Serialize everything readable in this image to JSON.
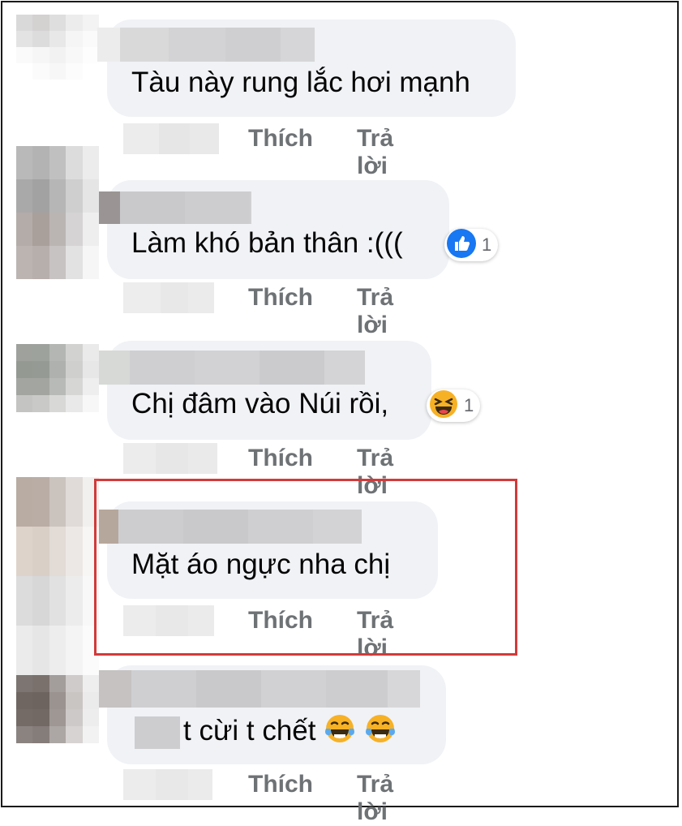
{
  "comments": [
    {
      "text": "Tàu này rung lắc hơi mạnh",
      "like": "Thích",
      "reply": "Trả lời"
    },
    {
      "text": "Làm khó bản thân :(((",
      "like": "Thích",
      "reply": "Trả lời",
      "reaction": {
        "icon": "like-icon",
        "count": "1"
      }
    },
    {
      "text": "Chị đâm vào Núi rồi,",
      "like": "Thích",
      "reply": "Trả lời",
      "reaction": {
        "icon": "laughing-emoji-icon",
        "count": "1"
      }
    },
    {
      "text": "Mặt áo ngực nha chị",
      "like": "Thích",
      "reply": "Trả lời",
      "highlighted": true
    },
    {
      "text": "t cừi t chết",
      "like": "Thích",
      "reply": "Trả lời",
      "emojis": [
        "tears-of-joy-emoji-icon",
        "tears-of-joy-emoji-icon"
      ]
    }
  ],
  "colors": {
    "highlight": "#d23a3a",
    "bubble": "#f0f2f5",
    "action": "#6e7275",
    "like_blue": "#1877f2"
  }
}
